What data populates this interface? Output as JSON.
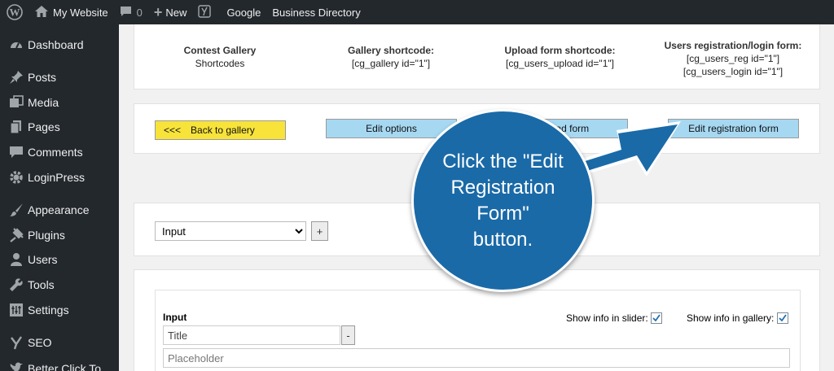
{
  "admin_bar": {
    "site_name": "My Website",
    "comments_count": "0",
    "new_label": "New",
    "google_label": "Google",
    "directory_label": "Business Directory"
  },
  "sidebar": {
    "items": [
      {
        "label": "Dashboard",
        "icon": "dashboard-icon"
      },
      {
        "label": "Posts",
        "icon": "pin-icon"
      },
      {
        "label": "Media",
        "icon": "media-icon"
      },
      {
        "label": "Pages",
        "icon": "pages-icon"
      },
      {
        "label": "Comments",
        "icon": "comments-icon"
      },
      {
        "label": "LoginPress",
        "icon": "gear-icon"
      },
      {
        "label": "Appearance",
        "icon": "brush-icon"
      },
      {
        "label": "Plugins",
        "icon": "plugin-icon"
      },
      {
        "label": "Users",
        "icon": "user-icon"
      },
      {
        "label": "Tools",
        "icon": "wrench-icon"
      },
      {
        "label": "Settings",
        "icon": "settings-icon"
      },
      {
        "label": "SEO",
        "icon": "yoast-icon"
      },
      {
        "label": "Better Click To",
        "icon": "twitter-icon"
      }
    ]
  },
  "shortcodes": {
    "gallery_title": "Contest Gallery",
    "gallery_sub": "Shortcodes",
    "gallery_sc_head": "Gallery shortcode:",
    "gallery_sc": "[cg_gallery id=\"1\"]",
    "upload_head": "Upload form shortcode:",
    "upload_sc": "[cg_users_upload id=\"1\"]",
    "reg_head": "Users registration/login form:",
    "reg_sc1": "[cg_users_reg id=\"1\"]",
    "reg_sc2": "[cg_users_login id=\"1\"]"
  },
  "nav": {
    "back_arrows": "<<<",
    "back": "Back to gallery",
    "edit_options": "Edit options",
    "upload_form": "Upload form",
    "edit_reg": "Edit registration form"
  },
  "field_type": {
    "selected": "Input",
    "add_label": "+"
  },
  "input_field": {
    "heading": "Input",
    "title_value": "Title",
    "remove_label": "-",
    "placeholder_value": "Placeholder",
    "show_slider": "Show info in slider:",
    "show_gallery": "Show info in gallery:",
    "show_slider_checked": true,
    "show_gallery_checked": true
  },
  "callout": {
    "line1": "Click the \"Edit",
    "line2": "Registration Form\"",
    "line3": "button."
  },
  "colors": {
    "admin_bg": "#23282d",
    "back_btn": "#f7e33a",
    "blue_btn": "#a6d8f2",
    "callout": "#1a6aa8"
  }
}
